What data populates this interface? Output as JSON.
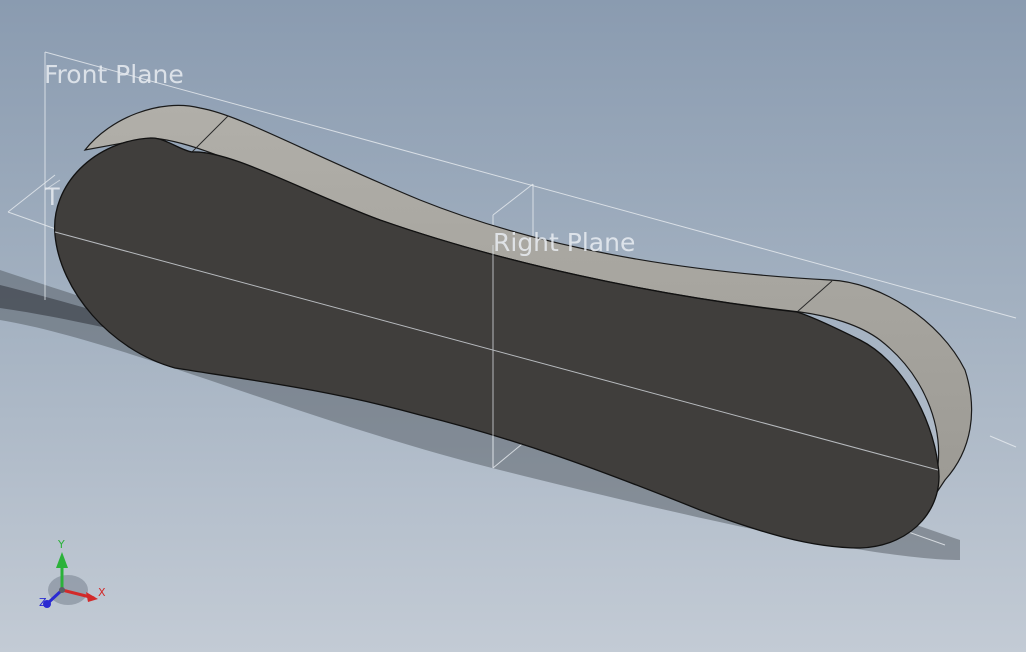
{
  "viewport": {
    "planes": {
      "front": "Front Plane",
      "right": "Right Plane",
      "top": "T"
    },
    "triad": {
      "x_label": "X",
      "y_label": "Y",
      "z_label": "Z",
      "x_color": "#d22a2a",
      "y_color": "#2bb23a",
      "z_color": "#2a2ad2"
    },
    "model": {
      "face_color": "#3f3d3b",
      "side_color": "#a9a7a1"
    }
  }
}
